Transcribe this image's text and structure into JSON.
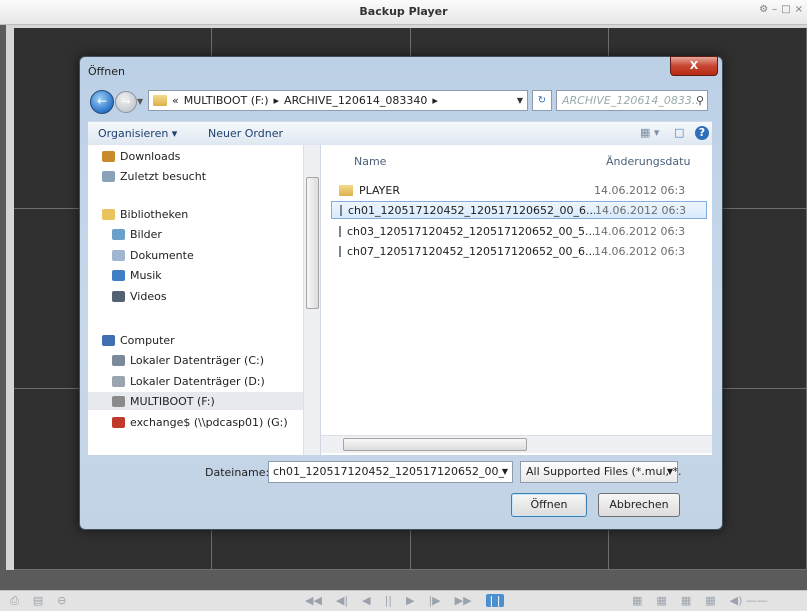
{
  "player": {
    "title": "Backup Player",
    "window_controls": [
      "⚙",
      "–",
      "□",
      "×"
    ],
    "toolbar_left": [
      "⎙",
      "▤",
      "⊖"
    ],
    "toolbar_center": [
      "◀◀",
      "◀|",
      "◀",
      "||",
      "▶",
      "|▶",
      "▶▶",
      "| |"
    ],
    "toolbar_right": [
      "▦",
      "▦",
      "▦",
      "▦",
      "◀) ——"
    ]
  },
  "dialog": {
    "title": "Öffnen",
    "close_label": "X",
    "address": {
      "prefix": "«",
      "segments": [
        "MULTIBOOT (F:)",
        "▸",
        "ARCHIVE_120614_083340",
        "▸"
      ]
    },
    "search_placeholder": "ARCHIVE_120614_0833...",
    "commands": {
      "organize": "Organisieren ▾",
      "new_folder": "Neuer Ordner"
    },
    "nav_items": [
      {
        "label": "Downloads",
        "icon": "downloads-icon",
        "color": "#c98a2c"
      },
      {
        "label": "Zuletzt besucht",
        "icon": "recent-icon",
        "color": "#8aa2b8"
      },
      {
        "label": "Bibliotheken",
        "icon": "libraries-icon",
        "color": "#e9c35e"
      },
      {
        "label": "Bilder",
        "icon": "pictures-icon",
        "color": "#6aa0c9"
      },
      {
        "label": "Dokumente",
        "icon": "documents-icon",
        "color": "#9fb6d1"
      },
      {
        "label": "Musik",
        "icon": "music-icon",
        "color": "#3f7fc4"
      },
      {
        "label": "Videos",
        "icon": "videos-icon",
        "color": "#556273"
      },
      {
        "label": "Computer",
        "icon": "computer-icon",
        "color": "#3f6fb0"
      },
      {
        "label": "Lokaler Datenträger (C:)",
        "icon": "drive-c-icon",
        "color": "#7a8a9a"
      },
      {
        "label": "Lokaler Datenträger (D:)",
        "icon": "drive-d-icon",
        "color": "#9aa5b0"
      },
      {
        "label": "MULTIBOOT (F:)",
        "icon": "drive-f-icon",
        "color": "#8a8a8a"
      },
      {
        "label": "exchange$ (\\\\pdcasp01) (G:)",
        "icon": "network-drive-icon",
        "color": "#c0392b"
      }
    ],
    "columns": {
      "name": "Name",
      "modified": "Änderungsdatu"
    },
    "files": [
      {
        "name": "PLAYER",
        "date": "14.06.2012 06:3",
        "type": "folder"
      },
      {
        "name": "ch01_120517120452_120517120652_00_6...",
        "date": "14.06.2012 06:3",
        "type": "file"
      },
      {
        "name": "ch03_120517120452_120517120652_00_5...",
        "date": "14.06.2012 06:3",
        "type": "file"
      },
      {
        "name": "ch07_120517120452_120517120652_00_6...",
        "date": "14.06.2012 06:3",
        "type": "file"
      }
    ],
    "filename_label": "Dateiname:",
    "filename_value": "ch01_120517120452_120517120652_00_",
    "filter_value": "All Supported Files (*.mul, *.",
    "open_label": "Öffnen",
    "cancel_label": "Abbrechen"
  }
}
